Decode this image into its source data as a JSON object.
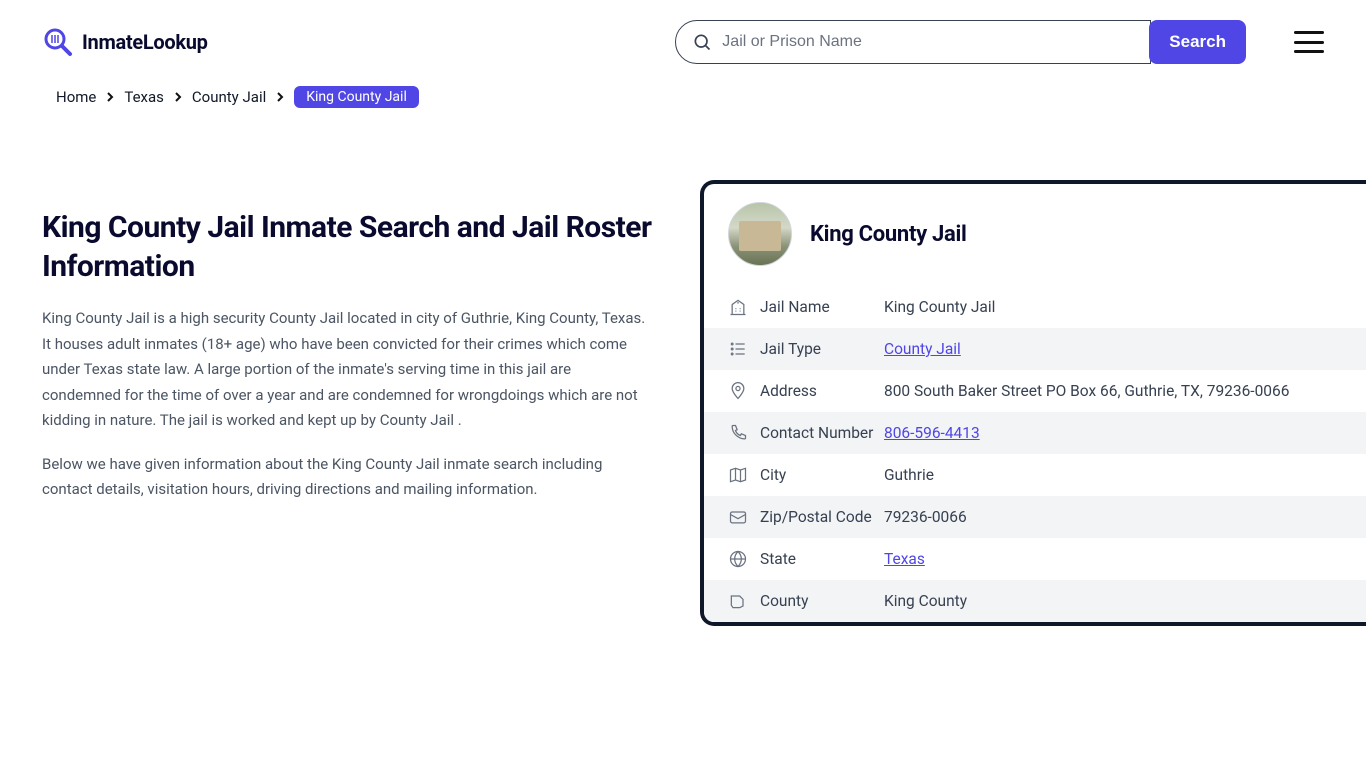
{
  "header": {
    "logo_text": "InmateLookup",
    "search_placeholder": "Jail or Prison Name",
    "search_button": "Search"
  },
  "breadcrumb": {
    "items": [
      "Home",
      "Texas",
      "County Jail"
    ],
    "current": "King County Jail"
  },
  "content": {
    "title": "King County Jail Inmate Search and Jail Roster Information",
    "para1": "King County Jail is a high security County Jail located in city of Guthrie, King County, Texas. It houses adult inmates (18+ age) who have been convicted for their crimes which come under Texas state law. A large portion of the inmate's serving time in this jail are condemned for the time of over a year and are condemned for wrongdoings which are not kidding in nature. The jail is worked and kept up by County Jail .",
    "para2": "Below we have given information about the King County Jail inmate search including contact details, visitation hours, driving directions and mailing information."
  },
  "card": {
    "title": "King County Jail",
    "rows": [
      {
        "icon": "building",
        "label": "Jail Name",
        "value": "King County Jail",
        "link": false
      },
      {
        "icon": "list",
        "label": "Jail Type",
        "value": "County Jail",
        "link": true
      },
      {
        "icon": "pin",
        "label": "Address",
        "value": "800 South Baker Street PO Box 66, Guthrie, TX, 79236-0066",
        "link": false
      },
      {
        "icon": "phone",
        "label": "Contact Number",
        "value": "806-596-4413",
        "link": true
      },
      {
        "icon": "map",
        "label": "City",
        "value": "Guthrie",
        "link": false
      },
      {
        "icon": "mail",
        "label": "Zip/Postal Code",
        "value": "79236-0066",
        "link": false
      },
      {
        "icon": "globe",
        "label": "State",
        "value": "Texas",
        "link": true
      },
      {
        "icon": "shape",
        "label": "County",
        "value": "King County",
        "link": false
      }
    ]
  }
}
